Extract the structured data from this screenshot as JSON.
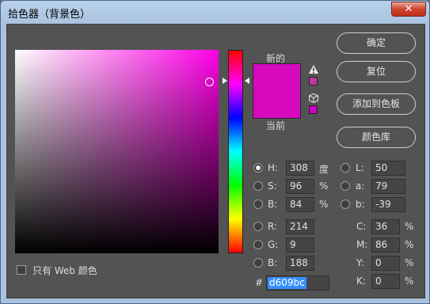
{
  "window": {
    "title": "拾色器（背景色）",
    "close": "✕"
  },
  "labels": {
    "new": "新的",
    "current": "当前"
  },
  "colors": {
    "new": "#d609bc",
    "current": "#d609bc",
    "hue_pure": "#ff00e6"
  },
  "buttons": {
    "ok": "确定",
    "reset": "复位",
    "add_swatch": "添加到色板",
    "libraries": "颜色库"
  },
  "hsb": [
    {
      "label": "H:",
      "value": "308",
      "unit": "度",
      "selected": true
    },
    {
      "label": "S:",
      "value": "96",
      "unit": "%",
      "selected": false
    },
    {
      "label": "B:",
      "value": "84",
      "unit": "%",
      "selected": false
    }
  ],
  "rgb": [
    {
      "label": "R:",
      "value": "214"
    },
    {
      "label": "G:",
      "value": "9"
    },
    {
      "label": "B:",
      "value": "188"
    }
  ],
  "lab": [
    {
      "label": "L:",
      "value": "50"
    },
    {
      "label": "a:",
      "value": "79"
    },
    {
      "label": "b:",
      "value": "-39"
    }
  ],
  "cmyk": [
    {
      "label": "C:",
      "value": "36",
      "unit": "%"
    },
    {
      "label": "M:",
      "value": "86",
      "unit": "%"
    },
    {
      "label": "Y:",
      "value": "0",
      "unit": "%"
    },
    {
      "label": "K:",
      "value": "0",
      "unit": "%"
    }
  ],
  "hex": {
    "prefix": "#",
    "value": "d609bc"
  },
  "web_only": {
    "label": "只有 Web 颜色",
    "checked": false
  },
  "icons": {
    "gamut_warning": "warning-triangle-icon",
    "web_safe": "cube-icon"
  }
}
